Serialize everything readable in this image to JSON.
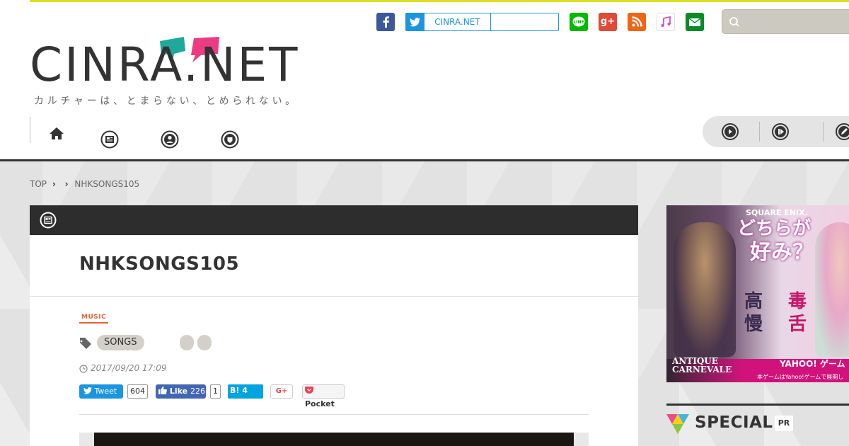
{
  "header": {
    "logo_text": "CINRA.NET",
    "tagline": "カルチャーは、とまらない、とめられない。",
    "twitter_follow_label": "CINRA.NET",
    "search": {
      "placeholder": ""
    },
    "social_icons": [
      "facebook-icon",
      "twitter-icon",
      "line-icon",
      "google-plus-icon",
      "rss-icon",
      "itunes-icon",
      "mail-icon"
    ],
    "line_label": "LINE",
    "gplus_label": "g+"
  },
  "nav": {
    "items": [
      "home-icon",
      "news-icon",
      "people-icon",
      "event-icon"
    ],
    "right_items": [
      "video-icon",
      "play-icon",
      "edit-icon"
    ]
  },
  "breadcrumb": {
    "items": [
      "TOP",
      "NHKSONGS105"
    ]
  },
  "article": {
    "title": "NHKSONGS105",
    "genre": "MUSIC",
    "tags": [
      "SONGS"
    ],
    "date": "2017/09/20 17:09",
    "share": {
      "tweet_label": "Tweet",
      "tweet_count": "604",
      "like_label": "Like",
      "like_count": "226",
      "like_count2": "1",
      "hatena_label": "B!",
      "hatena_count": "4",
      "gplus_label": "G+",
      "pocket_label": "Pocket"
    }
  },
  "ad": {
    "brand": "SQUARE ENIX.",
    "headline1": "どちらが",
    "headline2": "好み？",
    "left_word": "高慢",
    "right_word": "毒舌",
    "game_logo": "ANTIQUE CARNEVALE",
    "platform": "YAHOO! ゲーム",
    "footer": "本ゲームはYahoo!ゲームで展開し"
  },
  "sidebar": {
    "special_label": "SPECIAL",
    "pr_badge": "PR"
  },
  "colors": {
    "accent_line": "#d9e021",
    "dark": "#2d2d2d",
    "twitter": "#1b95e0",
    "facebook": "#3b5998",
    "genre": "#e8623a"
  }
}
